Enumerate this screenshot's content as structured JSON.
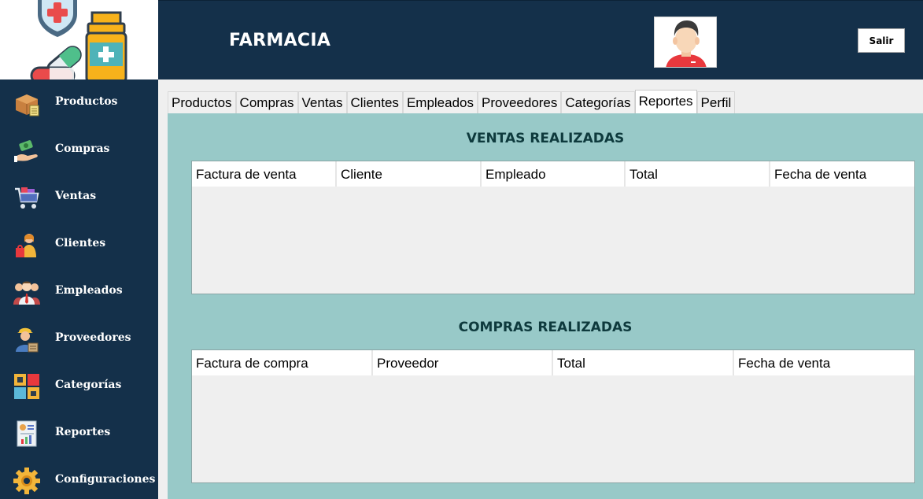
{
  "header": {
    "title": "FARMACIA",
    "exit_label": "Salir"
  },
  "sidebar": {
    "items": [
      {
        "label": "Productos",
        "icon": "boxes-icon"
      },
      {
        "label": "Compras",
        "icon": "money-hand-icon"
      },
      {
        "label": "Ventas",
        "icon": "shopping-cart-icon"
      },
      {
        "label": "Clientes",
        "icon": "customer-bags-icon"
      },
      {
        "label": "Empleados",
        "icon": "employees-icon"
      },
      {
        "label": "Proveedores",
        "icon": "supplier-worker-icon"
      },
      {
        "label": "Categorías",
        "icon": "categories-grid-icon"
      },
      {
        "label": "Reportes",
        "icon": "report-document-icon"
      },
      {
        "label": "Configuraciones",
        "icon": "gear-icon"
      }
    ]
  },
  "tabs": [
    "Productos",
    "Compras",
    "Ventas",
    "Clientes",
    "Empleados",
    "Proveedores",
    "Categorías",
    "Reportes",
    "Perfil"
  ],
  "active_tab": "Reportes",
  "reports": {
    "sales": {
      "title": "VENTAS REALIZADAS",
      "columns": [
        "Factura de venta",
        "Cliente",
        "Empleado",
        "Total",
        "Fecha de venta"
      ]
    },
    "purchases": {
      "title": "COMPRAS REALIZADAS",
      "columns": [
        "Factura de compra",
        "Proveedor",
        "Total",
        "Fecha de venta"
      ]
    }
  },
  "colors": {
    "navy": "#14304a",
    "panel_teal": "#98c9c8",
    "title_text": "#0e3a3d",
    "header_text": "#ffffff"
  }
}
